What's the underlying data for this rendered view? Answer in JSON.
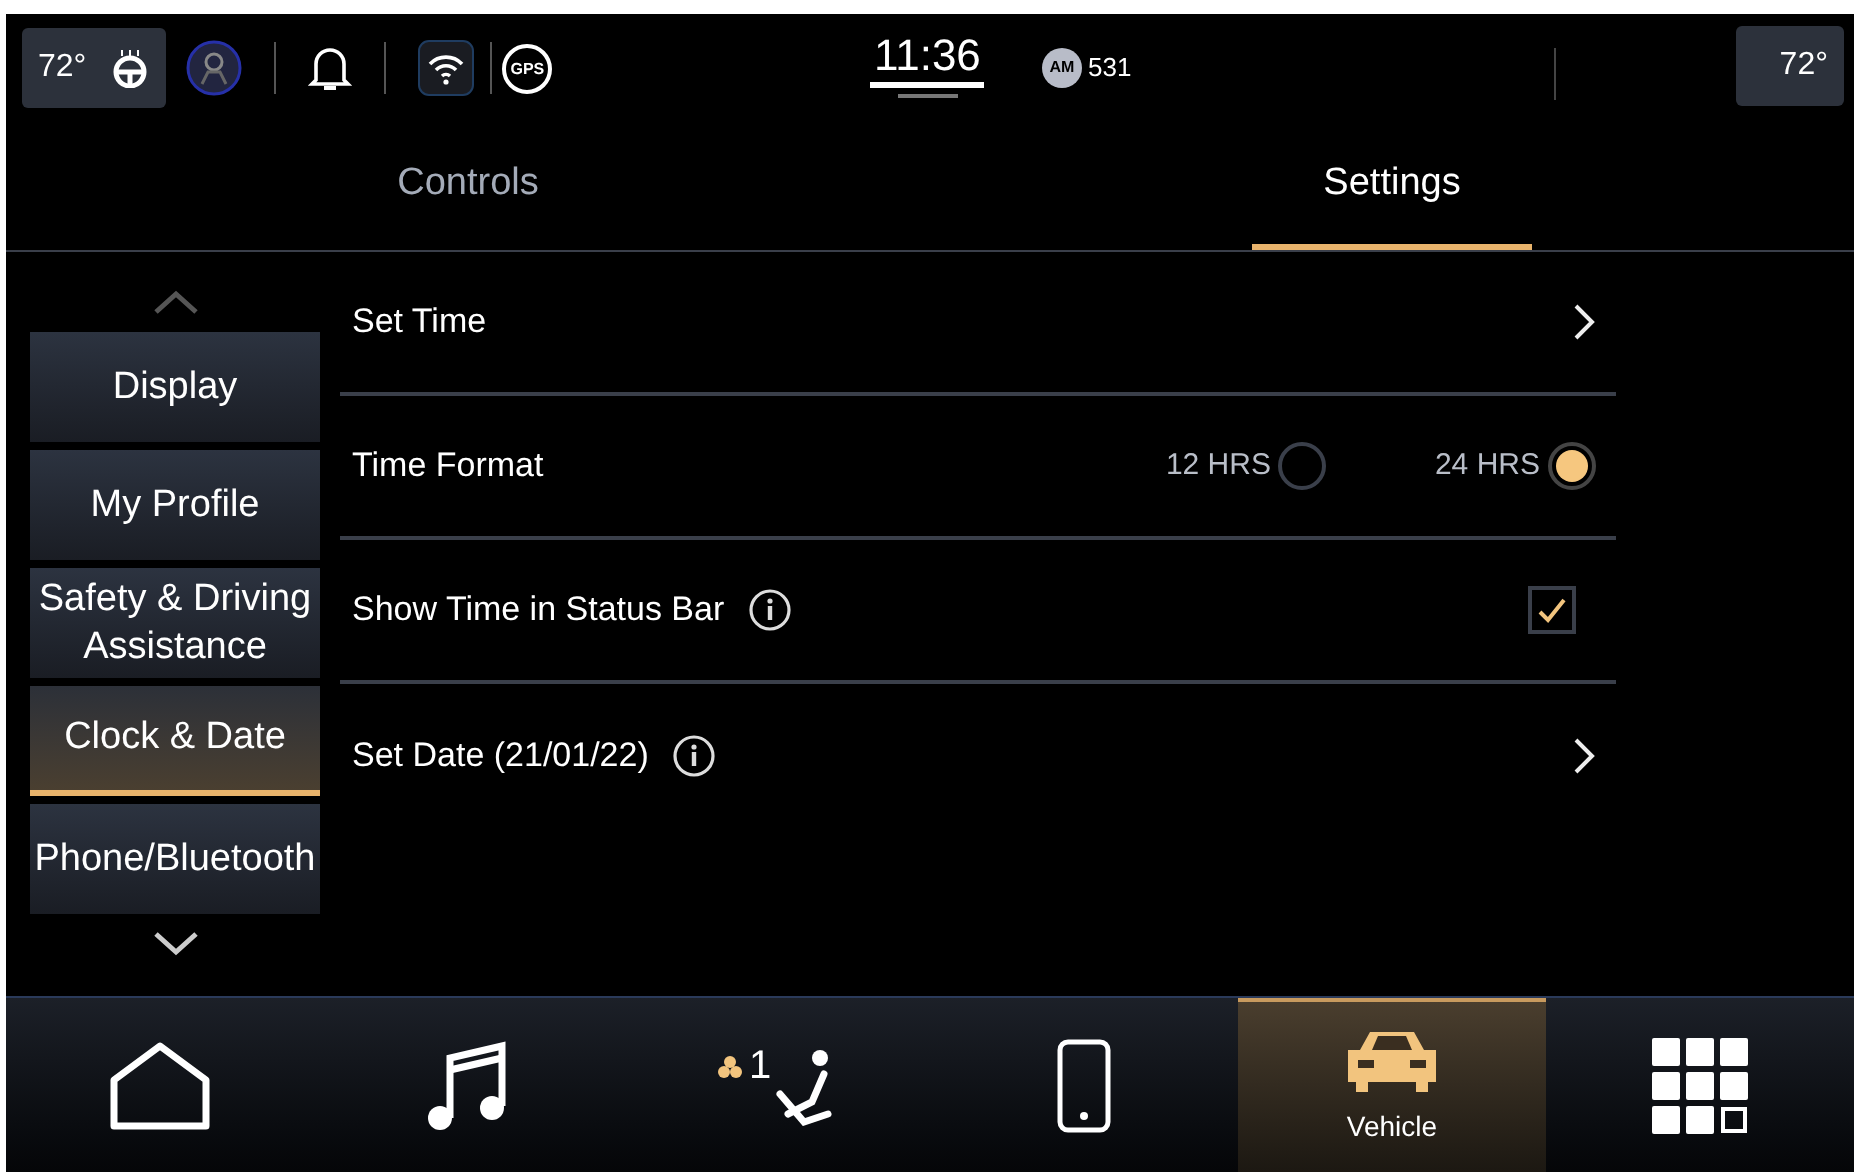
{
  "status_bar": {
    "left_temp": "72°",
    "gps_label": "GPS",
    "time": "11:36",
    "radio_band": "AM",
    "radio_station": "531",
    "right_temp": "72°"
  },
  "tabs": [
    {
      "label": "Controls",
      "selected": false
    },
    {
      "label": "Settings",
      "selected": true
    }
  ],
  "sidebar": {
    "items": [
      {
        "label": "Display",
        "selected": false
      },
      {
        "label": "My Profile",
        "selected": false
      },
      {
        "label": "Safety & Driving Assistance",
        "selected": false
      },
      {
        "label": "Clock & Date",
        "selected": true
      },
      {
        "label": "Phone/Bluetooth",
        "selected": false
      }
    ]
  },
  "settings": [
    {
      "kind": "link",
      "label": "Set Time",
      "info": false
    },
    {
      "kind": "radio",
      "label": "Time Format",
      "options": [
        {
          "label": "12 HRS",
          "selected": false
        },
        {
          "label": "24 HRS",
          "selected": true
        }
      ]
    },
    {
      "kind": "checkbox",
      "label": "Show Time in Status Bar",
      "info": true,
      "checked": true
    },
    {
      "kind": "link",
      "label": "Set Date (21/01/22)",
      "info": true
    }
  ],
  "nav": [
    {
      "kind": "home",
      "selected": false
    },
    {
      "kind": "media",
      "selected": false
    },
    {
      "kind": "climate",
      "badge": "1",
      "selected": false
    },
    {
      "kind": "phone",
      "selected": false
    },
    {
      "kind": "vehicle",
      "label": "Vehicle",
      "selected": true
    },
    {
      "kind": "apps",
      "selected": false
    }
  ]
}
